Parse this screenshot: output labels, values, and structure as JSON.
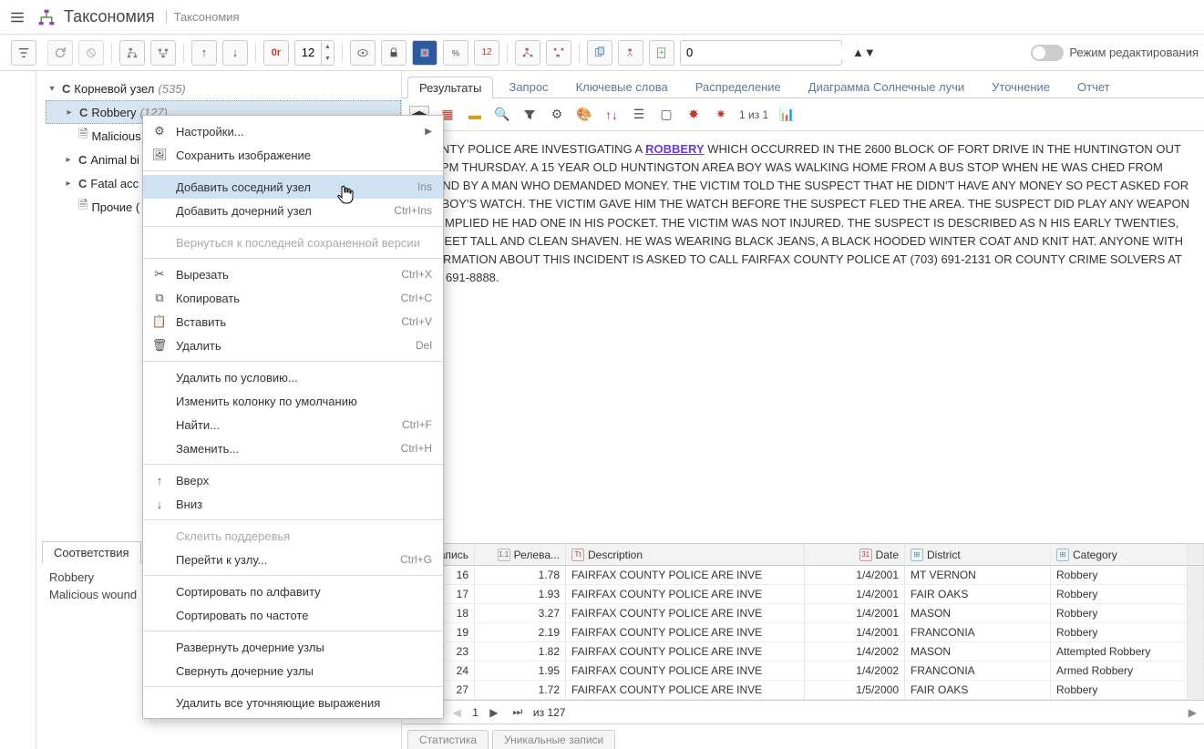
{
  "header": {
    "title": "Таксономия",
    "subtitle": "Таксономия"
  },
  "toolbar": {
    "or": "0r",
    "size": "12",
    "extra_num": "12",
    "counter": "0",
    "edit_mode": "Режим редактирования"
  },
  "tree": {
    "root_label": "Корневой узел",
    "root_count": "(535)",
    "items": [
      {
        "type": "C",
        "label": "Robbery",
        "count": "(127)",
        "caret": true
      },
      {
        "type": "doc",
        "label": "Malicious",
        "caret": false
      },
      {
        "type": "C",
        "label": "Animal bi",
        "caret": true
      },
      {
        "type": "C",
        "label": "Fatal acc",
        "caret": true
      },
      {
        "type": "doc",
        "label": "Прочие (",
        "caret": false
      }
    ]
  },
  "match_tab": "Соответствия",
  "matches": [
    "Robbery",
    "Malicious wound"
  ],
  "tabs": [
    "Результаты",
    "Запрос",
    "Ключевые слова",
    "Распределение",
    "Диаграмма Солнечные лучи",
    "Уточнение",
    "Отчет"
  ],
  "result_counter": "1 из 1",
  "body_pre": " COUNTY POLICE ARE INVESTIGATING A ",
  "body_hl": "ROBBERY",
  "body_post": " WHICH OCCURRED IN THE 2600 BLOCK OF FORT DRIVE IN THE HUNTINGTON OUT 4:30 PM THURSDAY. A 15 YEAR OLD HUNTINGTON AREA BOY WAS WALKING HOME FROM A BUS STOP WHEN HE WAS CHED FROM BEHIND BY A MAN WHO DEMANDED MONEY. THE VICTIM TOLD THE SUSPECT THAT HE DIDN'T HAVE ANY MONEY SO PECT ASKED FOR THE BOY'S WATCH. THE VICTIM GAVE HIM THE WATCH BEFORE THE SUSPECT FLED THE AREA. THE SUSPECT DID PLAY ANY WEAPON BUT IMPLIED HE HAD ONE IN HIS POCKET. THE VICTIM WAS NOT INJURED. THE SUSPECT IS DESCRIBED AS N HIS EARLY TWENTIES, SIX FEET TALL AND CLEAN SHAVEN. HE WAS WEARING BLACK JEANS, A BLACK HOODED WINTER COAT AND KNIT HAT. ANYONE WITH INFORMATION ABOUT THIS INCIDENT IS ASKED TO CALL FAIRFAX COUNTY POLICE AT (703) 691-2131 OR COUNTY CRIME SOLVERS AT (703) 691-8888.",
  "grid": {
    "headers": {
      "record": "Запись",
      "relev": "Релева...",
      "desc": "Description",
      "date": "Date",
      "district": "District",
      "category": "Category"
    },
    "rows": [
      {
        "rec": "16",
        "rel": "1.78",
        "desc": "FAIRFAX COUNTY POLICE ARE INVE",
        "date": "1/4/2001",
        "dist": "MT VERNON",
        "cat": "Robbery"
      },
      {
        "rec": "17",
        "rel": "1.93",
        "desc": "FAIRFAX COUNTY POLICE ARE INVE",
        "date": "1/4/2001",
        "dist": "FAIR OAKS",
        "cat": "Robbery"
      },
      {
        "rec": "18",
        "rel": "3.27",
        "desc": "FAIRFAX COUNTY POLICE ARE INVE",
        "date": "1/4/2001",
        "dist": "MASON",
        "cat": "Robbery"
      },
      {
        "rec": "19",
        "rel": "2.19",
        "desc": "FAIRFAX COUNTY POLICE ARE INVE",
        "date": "1/4/2001",
        "dist": "FRANCONIA",
        "cat": "Robbery"
      },
      {
        "rec": "23",
        "rel": "1.82",
        "desc": "FAIRFAX COUNTY POLICE ARE INVE",
        "date": "1/4/2002",
        "dist": "MASON",
        "cat": "Attempted Robbery"
      },
      {
        "rec": "24",
        "rel": "1.95",
        "desc": "FAIRFAX COUNTY POLICE ARE INVE",
        "date": "1/4/2002",
        "dist": "FRANCONIA",
        "cat": "Armed Robbery"
      },
      {
        "rec": "27",
        "rel": "1.72",
        "desc": "FAIRFAX COUNTY POLICE ARE INVE",
        "date": "1/5/2000",
        "dist": "FAIR OAKS",
        "cat": "Robbery"
      }
    ],
    "page": "1",
    "of": "из 127"
  },
  "bottom_tabs": [
    "Статистика",
    "Уникальные записи"
  ],
  "context_menu": [
    {
      "icon": "settings",
      "label": "Настройки...",
      "arrow": true
    },
    {
      "icon": "image",
      "label": "Сохранить изображение"
    },
    {
      "sep": true
    },
    {
      "label": "Добавить соседний узел",
      "sc": "Ins",
      "highlight": true
    },
    {
      "label": "Добавить дочерний узел",
      "sc": "Ctrl+Ins"
    },
    {
      "sep": true
    },
    {
      "label": "Вернуться к последней сохраненной версии",
      "disabled": true
    },
    {
      "sep": true
    },
    {
      "icon": "cut",
      "label": "Вырезать",
      "sc": "Ctrl+X"
    },
    {
      "icon": "copy",
      "label": "Копировать",
      "sc": "Ctrl+C"
    },
    {
      "icon": "paste",
      "label": "Вставить",
      "sc": "Ctrl+V"
    },
    {
      "icon": "trash",
      "label": "Удалить",
      "sc": "Del"
    },
    {
      "sep": true
    },
    {
      "label": "Удалить по условию..."
    },
    {
      "label": "Изменить колонку по умолчанию"
    },
    {
      "label": "Найти...",
      "sc": "Ctrl+F"
    },
    {
      "label": "Заменить...",
      "sc": "Ctrl+H"
    },
    {
      "sep": true
    },
    {
      "icon": "up",
      "label": "Вверх"
    },
    {
      "icon": "down",
      "label": "Вниз"
    },
    {
      "sep": true
    },
    {
      "label": "Склеить поддеревья",
      "disabled": true
    },
    {
      "label": "Перейти к узлу...",
      "sc": "Ctrl+G"
    },
    {
      "sep": true
    },
    {
      "label": "Сортировать по алфавиту"
    },
    {
      "label": "Сортировать по частоте"
    },
    {
      "sep": true
    },
    {
      "label": "Развернуть дочерние узлы"
    },
    {
      "label": "Свернуть дочерние узлы"
    },
    {
      "sep": true
    },
    {
      "label": "Удалить все уточняющие выражения"
    }
  ],
  "icons": {
    "12_badge": "12"
  }
}
